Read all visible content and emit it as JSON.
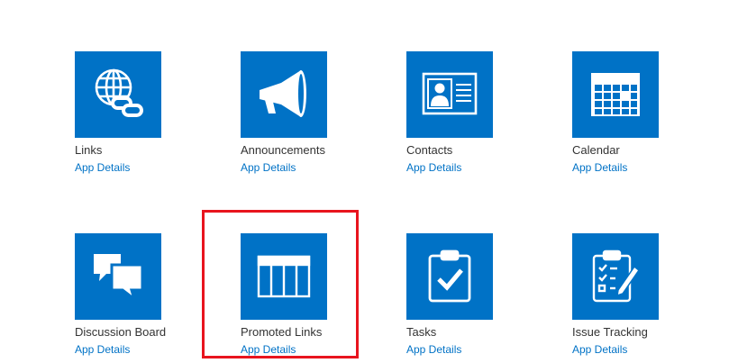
{
  "apps": [
    {
      "name": "Links",
      "details": "App Details",
      "icon": "globe-chain-links-icon"
    },
    {
      "name": "Announcements",
      "details": "App Details",
      "icon": "megaphone-icon"
    },
    {
      "name": "Contacts",
      "details": "App Details",
      "icon": "contact-card-icon"
    },
    {
      "name": "Calendar",
      "details": "App Details",
      "icon": "calendar-icon"
    },
    {
      "name": "Discussion Board",
      "details": "App Details",
      "icon": "chat-bubbles-icon"
    },
    {
      "name": "Promoted Links",
      "details": "App Details",
      "icon": "promoted-links-icon"
    },
    {
      "name": "Tasks",
      "details": "App Details",
      "icon": "clipboard-check-icon"
    },
    {
      "name": "Issue Tracking",
      "details": "App Details",
      "icon": "checklist-pencil-icon"
    }
  ],
  "colors": {
    "tile": "#0072c6",
    "link": "#0072c6",
    "highlight": "#e8141e"
  }
}
